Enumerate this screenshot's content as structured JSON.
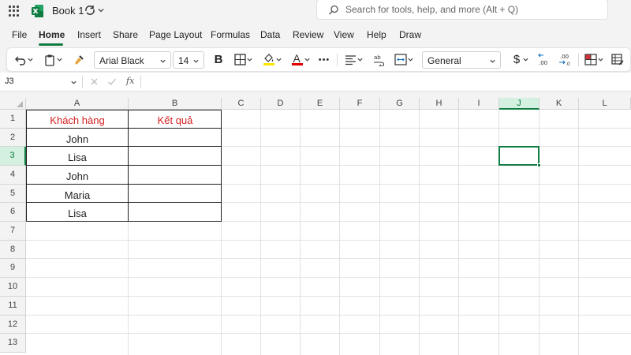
{
  "app": {
    "title": "Book 1",
    "search_placeholder": "Search for tools, help, and more (Alt + Q)"
  },
  "colors": {
    "accent": "#107c41",
    "header_text": "#d42020",
    "highlight_yellow": "#ffe600",
    "font_red": "#e00000"
  },
  "menu": {
    "items": [
      "File",
      "Home",
      "Insert",
      "Share",
      "Page Layout",
      "Formulas",
      "Data",
      "Review",
      "View",
      "Help",
      "Draw"
    ],
    "active": "Home"
  },
  "ribbon": {
    "font_name": "Arial Black",
    "font_size": "14",
    "number_format": "General",
    "bold_label": "B",
    "font_color_label": "A",
    "currency_label": "$",
    "more_label": "•••",
    "icons": [
      "undo-icon",
      "paste-icon",
      "format-painter-icon",
      "bold-icon",
      "borders-icon",
      "fill-color-icon",
      "font-color-icon",
      "more-icon",
      "align-icon",
      "wrap-text-icon",
      "merge-icon",
      "currency-icon",
      "decrease-decimal-icon",
      "increase-decimal-icon",
      "conditional-format-icon",
      "format-table-icon"
    ]
  },
  "formula_bar": {
    "name_box": "J3",
    "fx_label": "fx",
    "formula": ""
  },
  "grid": {
    "columns": [
      "A",
      "B",
      "C",
      "D",
      "E",
      "F",
      "G",
      "H",
      "I",
      "J",
      "K",
      "L"
    ],
    "rows": [
      "1",
      "2",
      "3",
      "4",
      "5",
      "6",
      "7",
      "8",
      "9",
      "10",
      "11",
      "12",
      "13"
    ],
    "selected_column": "J",
    "selected_row": "3",
    "table": {
      "headers": [
        "Khách hàng",
        "Kết quả"
      ],
      "rows": [
        [
          "John",
          ""
        ],
        [
          "Lisa",
          ""
        ],
        [
          "John",
          ""
        ],
        [
          "Maria",
          ""
        ],
        [
          "Lisa",
          ""
        ]
      ]
    }
  }
}
